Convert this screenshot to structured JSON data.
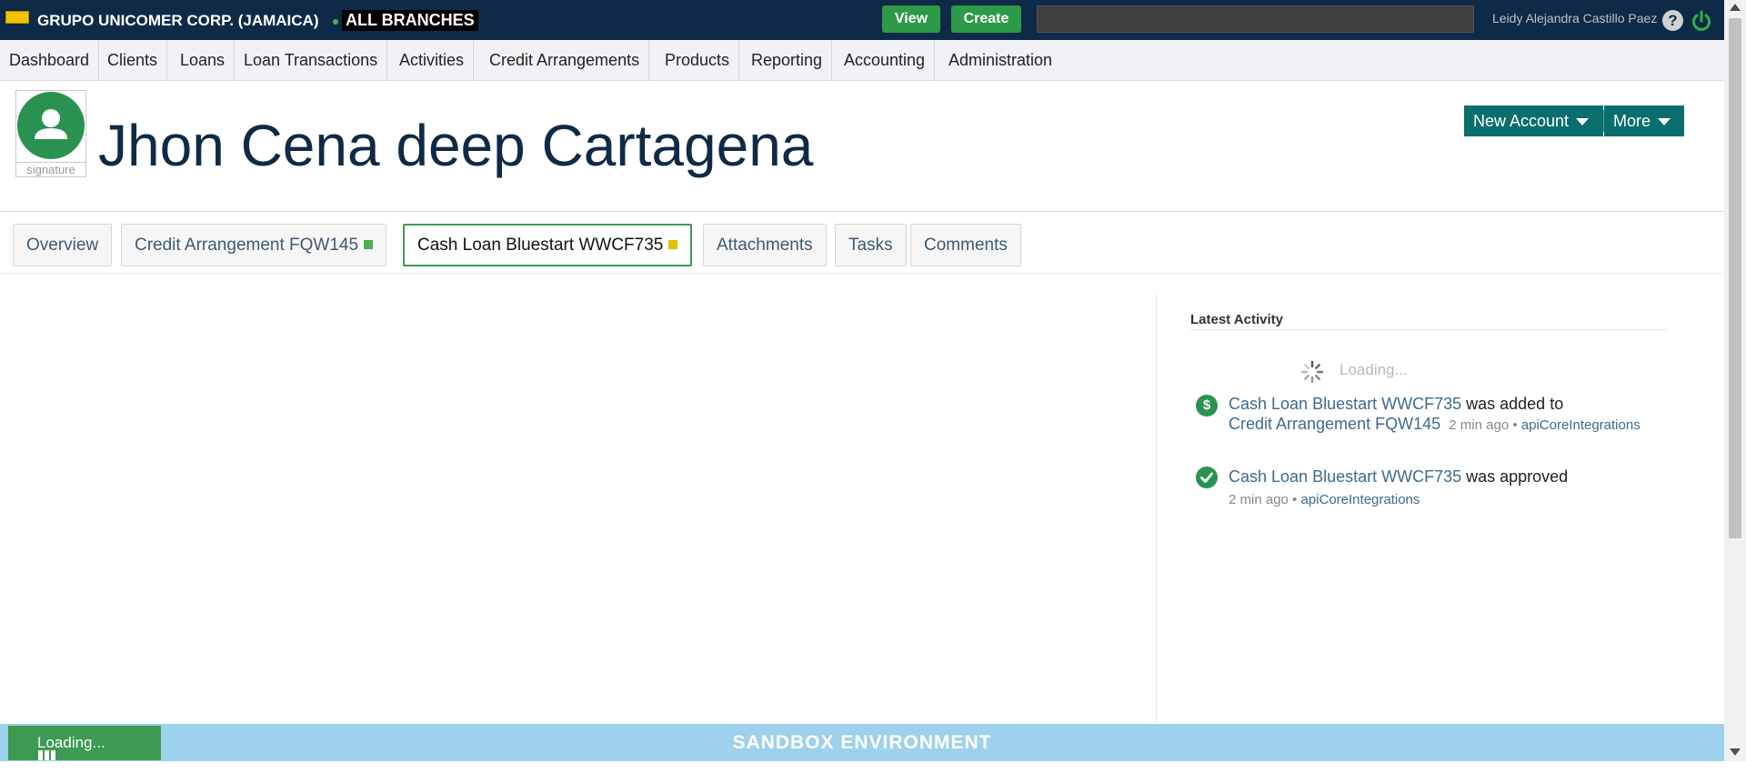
{
  "header": {
    "org_name": "GRUPO UNICOMER CORP. (JAMAICA)",
    "branch": "ALL BRANCHES",
    "view_label": "View",
    "create_label": "Create",
    "search_placeholder": "",
    "user_name": "Leidy Alejandra Castillo Paez",
    "help_icon": "help-icon",
    "power_icon": "power-icon",
    "brand_color": "#0f2a47",
    "accent_color": "#2d9a4a"
  },
  "menu": [
    "Dashboard",
    "Clients",
    "Loans",
    "Loan Transactions",
    "Activities",
    "Credit Arrangements",
    "Products",
    "Reporting",
    "Accounting",
    "Administration"
  ],
  "client": {
    "name": "Jhon Cena deep Cartagena",
    "signature_label": "signature",
    "avatar_icon": "person-icon"
  },
  "actions": {
    "new_account_label": "New Account",
    "more_label": "More"
  },
  "tabs": [
    {
      "label": "Overview"
    },
    {
      "label": "Credit Arrangement FQW145",
      "status_color": "#4caf50"
    },
    {
      "label": "Cash Loan Bluestart WWCF735",
      "status_color": "#e0c000",
      "active": true
    },
    {
      "label": "Attachments"
    },
    {
      "label": "Tasks"
    },
    {
      "label": "Comments"
    }
  ],
  "activity": {
    "title": "Latest Activity",
    "loading_text": "Loading...",
    "items": [
      {
        "icon": "dollar-icon",
        "link1": "Cash Loan Bluestart WWCF735",
        "text1": "was added to",
        "link2": "Credit Arrangement FQW145",
        "time": "2 min ago",
        "separator": "•",
        "user": "apiCoreIntegrations"
      },
      {
        "icon": "check-icon",
        "link1": "Cash Loan Bluestart WWCF735",
        "text1": "was approved",
        "time": "2 min ago",
        "separator": "•",
        "user": "apiCoreIntegrations"
      }
    ]
  },
  "footer": {
    "environment": "SANDBOX ENVIRONMENT",
    "loading_label": "Loading..."
  }
}
